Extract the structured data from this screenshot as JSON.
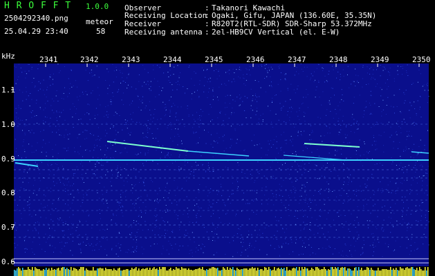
{
  "header": {
    "app_name": "H R O F F T",
    "version": "1.0.0",
    "filename": "2504292340.png",
    "mode": "meteor",
    "timestamp": "25.04.29 23:40",
    "count": "58",
    "fields": [
      {
        "label": "Observer",
        "sep": ":",
        "value": "Takanori Kawachi"
      },
      {
        "label": "Receiving Location",
        "sep": ":",
        "value": "Ogaki, Gifu, JAPAN (136.60E, 35.35N)"
      },
      {
        "label": "Receiver",
        "sep": ":",
        "value": "R820T2(RTL-SDR) SDR-Sharp 53.372MHz"
      },
      {
        "label": "Receiving antenna",
        "sep": ":",
        "value": "2el-HB9CV Vertical (el. E-W)"
      }
    ]
  },
  "axis": {
    "unit": "kHz",
    "y_ticks": [
      "1.1",
      "1.0",
      "0.9",
      "0.8",
      "0.7",
      "0.6"
    ],
    "x_ticks": [
      "2341",
      "2342",
      "2343",
      "2344",
      "2345",
      "2346",
      "2347",
      "2348",
      "2349",
      "2350"
    ]
  },
  "colors": {
    "background": "#000000",
    "spectrum_bg": "#0a0f8c",
    "header_green": "#3cff3c",
    "trace": "#3cd2ff",
    "meteor": "#7dffd0",
    "level_bar": "#ffff3c"
  }
}
